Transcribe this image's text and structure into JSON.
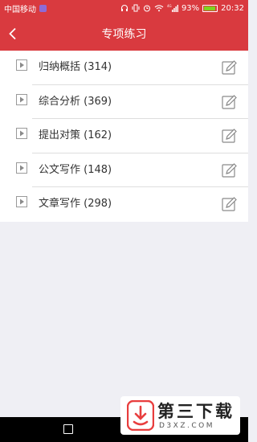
{
  "status_bar": {
    "carrier": "中国移动",
    "battery": "93%",
    "battery_level": 0.93,
    "time": "20:32",
    "network": "4G",
    "icons": [
      "app-badge-icon",
      "headphones-icon",
      "vibrate-icon",
      "alarm-icon",
      "wifi-icon",
      "signal-icon",
      "battery-icon"
    ]
  },
  "header": {
    "title": "专项练习",
    "back_icon": "chevron-left-icon",
    "background": "#d93a3f"
  },
  "items": [
    {
      "label": "归纳概括 (314)"
    },
    {
      "label": "综合分析 (369)"
    },
    {
      "label": "提出对策 (162)"
    },
    {
      "label": "公文写作 (148)"
    },
    {
      "label": "文章写作 (298)"
    }
  ],
  "watermark": {
    "text": "第三下载",
    "domain": "D3XZ.COM",
    "accent": "#e83e3e"
  }
}
